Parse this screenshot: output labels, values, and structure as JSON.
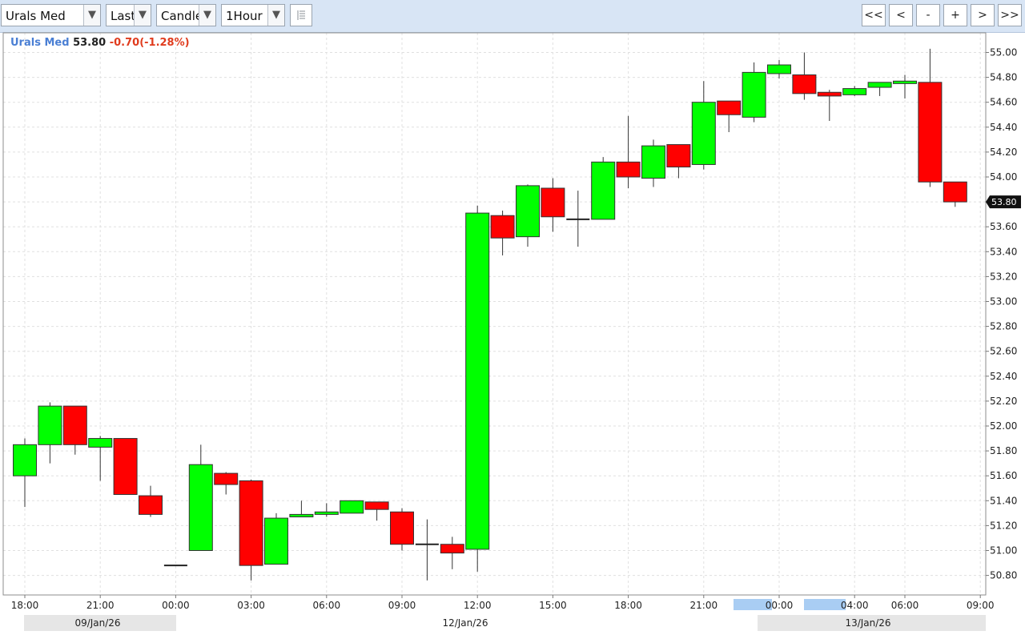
{
  "toolbar": {
    "symbol_select": "Urals Med",
    "price_type_select": "Last",
    "chart_type_select": "Candle",
    "interval_select": "1Hour",
    "grid_icon": "table-icon",
    "nav": {
      "first": "<<",
      "prev": "<",
      "zoom_out": "-",
      "zoom_in": "+",
      "next": ">",
      "last": ">>"
    }
  },
  "quote": {
    "symbol": "Urals Med",
    "last": "53.80",
    "change": "-0.70(-1.28%)"
  },
  "colors": {
    "up": "#00ff00",
    "down": "#ff0000",
    "grid": "#e0e0e0",
    "toolbar": "#d8e5f5",
    "highlight": "#a9cdf3"
  },
  "chart_data": {
    "type": "candlestick",
    "title": "",
    "ylim": [
      50.7,
      55.15
    ],
    "yticks": [
      "50.80",
      "51.00",
      "51.20",
      "51.40",
      "51.60",
      "51.80",
      "52.00",
      "52.20",
      "52.40",
      "52.60",
      "52.80",
      "53.00",
      "53.20",
      "53.40",
      "53.60",
      "53.80",
      "54.00",
      "54.20",
      "54.40",
      "54.60",
      "54.80",
      "55.00"
    ],
    "last_price_label": "53.80",
    "x_tick_labels": [
      "18:00",
      "21:00",
      "00:00",
      "03:00",
      "06:00",
      "09:00",
      "12:00",
      "15:00",
      "18:00",
      "21:00",
      "00:00",
      "04:00",
      "06:00",
      "09:00"
    ],
    "x_tick_hours": [
      0,
      3,
      6,
      9,
      12,
      15,
      18,
      21,
      24,
      27,
      30,
      33,
      35,
      38
    ],
    "highlighted_ticks": [
      "00:00",
      "04:00"
    ],
    "date_labels": [
      "09/Jan/26",
      "12/Jan/26",
      "13/Jan/26"
    ],
    "candles": [
      {
        "t": "09/Jan/26 18:00",
        "o": 51.6,
        "h": 51.9,
        "l": 51.35,
        "c": 51.85
      },
      {
        "t": "09/Jan/26 19:00",
        "o": 51.85,
        "h": 52.19,
        "l": 51.7,
        "c": 52.16
      },
      {
        "t": "09/Jan/26 20:00",
        "o": 52.16,
        "h": 52.16,
        "l": 51.77,
        "c": 51.85
      },
      {
        "t": "09/Jan/26 21:00",
        "o": 51.83,
        "h": 51.92,
        "l": 51.56,
        "c": 51.9
      },
      {
        "t": "09/Jan/26 22:00",
        "o": 51.9,
        "h": 51.9,
        "l": 51.45,
        "c": 51.45
      },
      {
        "t": "09/Jan/26 23:00",
        "o": 51.44,
        "h": 51.52,
        "l": 51.27,
        "c": 51.29
      },
      {
        "t": "12/Jan/26 00:00",
        "o": 50.88,
        "h": 50.88,
        "l": 50.88,
        "c": 50.88
      },
      {
        "t": "12/Jan/26 01:00",
        "o": 51.0,
        "h": 51.85,
        "l": 51.0,
        "c": 51.69
      },
      {
        "t": "12/Jan/26 02:00",
        "o": 51.62,
        "h": 51.63,
        "l": 51.45,
        "c": 51.53
      },
      {
        "t": "12/Jan/26 03:00",
        "o": 51.56,
        "h": 51.57,
        "l": 50.76,
        "c": 50.88
      },
      {
        "t": "12/Jan/26 04:00",
        "o": 50.89,
        "h": 51.3,
        "l": 50.89,
        "c": 51.26
      },
      {
        "t": "12/Jan/26 05:00",
        "o": 51.27,
        "h": 51.4,
        "l": 51.27,
        "c": 51.29
      },
      {
        "t": "12/Jan/26 06:00",
        "o": 51.29,
        "h": 51.38,
        "l": 51.27,
        "c": 51.31
      },
      {
        "t": "12/Jan/26 07:00",
        "o": 51.3,
        "h": 51.4,
        "l": 51.3,
        "c": 51.4
      },
      {
        "t": "12/Jan/26 08:00",
        "o": 51.39,
        "h": 51.39,
        "l": 51.24,
        "c": 51.33
      },
      {
        "t": "12/Jan/26 09:00",
        "o": 51.31,
        "h": 51.34,
        "l": 51.0,
        "c": 51.05
      },
      {
        "t": "12/Jan/26 10:00",
        "o": 51.05,
        "h": 51.25,
        "l": 50.76,
        "c": 51.05
      },
      {
        "t": "12/Jan/26 11:00",
        "o": 51.05,
        "h": 51.11,
        "l": 50.85,
        "c": 50.98
      },
      {
        "t": "12/Jan/26 12:00",
        "o": 51.01,
        "h": 53.77,
        "l": 50.83,
        "c": 53.71
      },
      {
        "t": "12/Jan/26 13:00",
        "o": 53.69,
        "h": 53.73,
        "l": 53.37,
        "c": 53.51
      },
      {
        "t": "12/Jan/26 14:00",
        "o": 53.52,
        "h": 53.94,
        "l": 53.44,
        "c": 53.93
      },
      {
        "t": "12/Jan/26 15:00",
        "o": 53.91,
        "h": 53.99,
        "l": 53.56,
        "c": 53.68
      },
      {
        "t": "12/Jan/26 16:00",
        "o": 53.66,
        "h": 53.89,
        "l": 53.44,
        "c": 53.66
      },
      {
        "t": "12/Jan/26 17:00",
        "o": 53.66,
        "h": 54.16,
        "l": 53.66,
        "c": 54.12
      },
      {
        "t": "12/Jan/26 18:00",
        "o": 54.12,
        "h": 54.49,
        "l": 53.91,
        "c": 54.0
      },
      {
        "t": "12/Jan/26 19:00",
        "o": 53.99,
        "h": 54.3,
        "l": 53.92,
        "c": 54.25
      },
      {
        "t": "12/Jan/26 20:00",
        "o": 54.26,
        "h": 54.26,
        "l": 53.99,
        "c": 54.08
      },
      {
        "t": "12/Jan/26 21:00",
        "o": 54.1,
        "h": 54.77,
        "l": 54.06,
        "c": 54.6
      },
      {
        "t": "12/Jan/26 22:00",
        "o": 54.61,
        "h": 54.61,
        "l": 54.36,
        "c": 54.5
      },
      {
        "t": "12/Jan/26 23:00",
        "o": 54.48,
        "h": 54.92,
        "l": 54.44,
        "c": 54.84
      },
      {
        "t": "13/Jan/26 00:00",
        "o": 54.83,
        "h": 54.94,
        "l": 54.79,
        "c": 54.9
      },
      {
        "t": "13/Jan/26 01:00",
        "o": 54.82,
        "h": 55.0,
        "l": 54.62,
        "c": 54.67
      },
      {
        "t": "13/Jan/26 02:00",
        "o": 54.68,
        "h": 54.7,
        "l": 54.45,
        "c": 54.65
      },
      {
        "t": "13/Jan/26 03:00",
        "o": 54.66,
        "h": 54.73,
        "l": 54.65,
        "c": 54.71
      },
      {
        "t": "13/Jan/26 04:00",
        "o": 54.72,
        "h": 54.76,
        "l": 54.65,
        "c": 54.76
      },
      {
        "t": "13/Jan/26 05:00",
        "o": 54.75,
        "h": 54.82,
        "l": 54.63,
        "c": 54.77
      },
      {
        "t": "13/Jan/26 06:00",
        "o": 54.76,
        "h": 55.03,
        "l": 53.92,
        "c": 53.96
      },
      {
        "t": "13/Jan/26 07:00",
        "o": 53.96,
        "h": 53.96,
        "l": 53.76,
        "c": 53.8
      }
    ]
  }
}
